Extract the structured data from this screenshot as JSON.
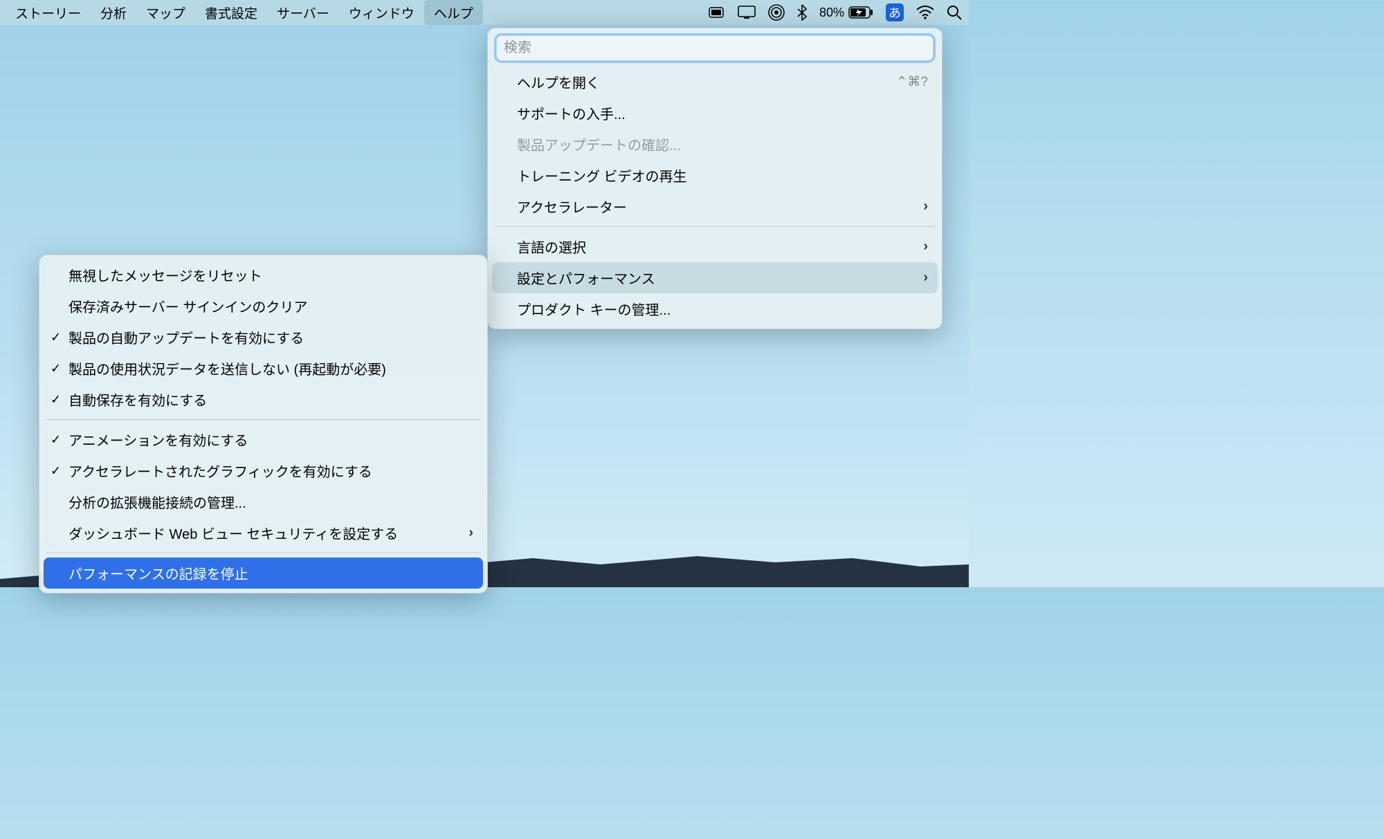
{
  "menubar": {
    "items": [
      "ストーリー",
      "分析",
      "マップ",
      "書式設定",
      "サーバー",
      "ウィンドウ",
      "ヘルプ"
    ],
    "active_index": 6
  },
  "status": {
    "battery_percent": "80%",
    "ime_label": "あ"
  },
  "help_menu": {
    "search_placeholder": "検索",
    "items": [
      {
        "label": "ヘルプを開く",
        "shortcut": "⌃⌘?",
        "submenu": false,
        "disabled": false
      },
      {
        "label": "サポートの入手...",
        "submenu": false,
        "disabled": false
      },
      {
        "label": "製品アップデートの確認...",
        "submenu": false,
        "disabled": true
      },
      {
        "label": "トレーニング ビデオの再生",
        "submenu": false,
        "disabled": false
      },
      {
        "label": "アクセラレーター",
        "submenu": true,
        "disabled": false
      },
      {
        "divider": true
      },
      {
        "label": "言語の選択",
        "submenu": true,
        "disabled": false
      },
      {
        "label": "設定とパフォーマンス",
        "submenu": true,
        "disabled": false,
        "hover": true
      },
      {
        "label": "プロダクト キーの管理...",
        "submenu": false,
        "disabled": false
      }
    ]
  },
  "sub_menu": {
    "items": [
      {
        "label": "無視したメッセージをリセット",
        "checked": false
      },
      {
        "label": "保存済みサーバー サインインのクリア",
        "checked": false
      },
      {
        "label": "製品の自動アップデートを有効にする",
        "checked": true
      },
      {
        "label": "製品の使用状況データを送信しない (再起動が必要)",
        "checked": true
      },
      {
        "label": "自動保存を有効にする",
        "checked": true
      },
      {
        "divider": true
      },
      {
        "label": "アニメーションを有効にする",
        "checked": true
      },
      {
        "label": "アクセラレートされたグラフィックを有効にする",
        "checked": true
      },
      {
        "label": "分析の拡張機能接続の管理...",
        "checked": false
      },
      {
        "label": "ダッシュボード Web ビュー セキュリティを設定する",
        "checked": false,
        "submenu": true
      },
      {
        "divider": true
      },
      {
        "label": "パフォーマンスの記録を停止",
        "checked": false,
        "selected": true
      }
    ]
  }
}
